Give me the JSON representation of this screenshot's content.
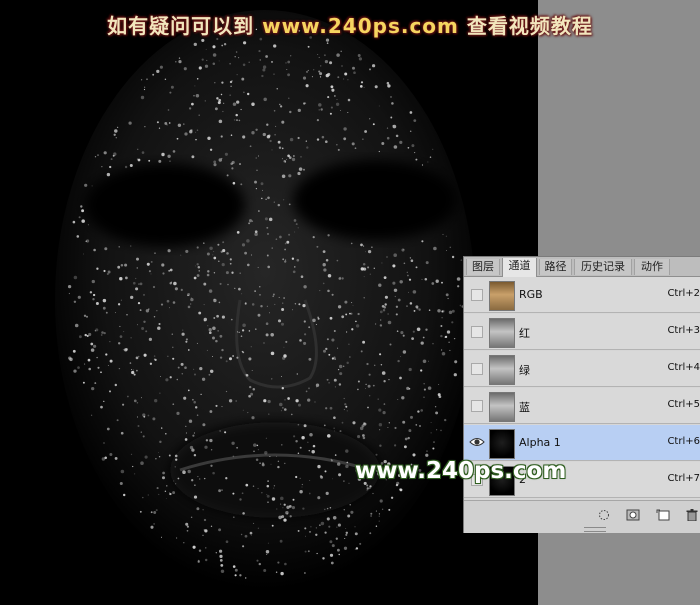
{
  "banner": {
    "prefix": "如有疑问可以到",
    "url": "www.240ps.com",
    "suffix": "查看视频教程"
  },
  "watermark": "www.240ps.com",
  "panel": {
    "tabs": [
      "图层",
      "通道",
      "路径",
      "历史记录",
      "动作"
    ],
    "active_tab": "通道",
    "channels": [
      {
        "name": "RGB",
        "shortcut": "Ctrl+2",
        "visible": false,
        "selected": false,
        "thumb": "color"
      },
      {
        "name": "红",
        "shortcut": "Ctrl+3",
        "visible": false,
        "selected": false,
        "thumb": "gray"
      },
      {
        "name": "绿",
        "shortcut": "Ctrl+4",
        "visible": false,
        "selected": false,
        "thumb": "gray"
      },
      {
        "name": "蓝",
        "shortcut": "Ctrl+5",
        "visible": false,
        "selected": false,
        "thumb": "gray"
      },
      {
        "name": "Alpha 1",
        "shortcut": "Ctrl+6",
        "visible": true,
        "selected": true,
        "thumb": "dark"
      },
      {
        "name": "2",
        "shortcut": "Ctrl+7",
        "visible": false,
        "selected": false,
        "thumb": "dark"
      }
    ],
    "bottom_icons": [
      "load-selection-icon",
      "save-selection-icon",
      "new-channel-icon",
      "trash-icon"
    ]
  },
  "colors": {
    "selected_row": "#b8cff3",
    "pasteboard": "#8d8d8d",
    "banner_url": "#f6d560"
  }
}
